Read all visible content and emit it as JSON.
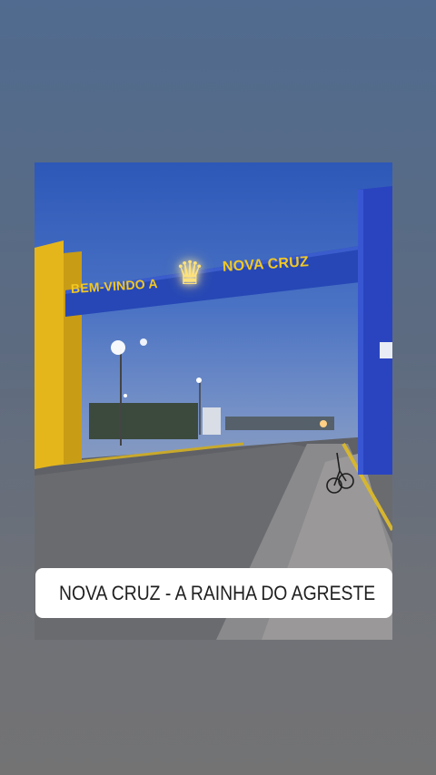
{
  "story": {
    "photo": {
      "arch_sign_left": "BEM-VINDO A",
      "arch_sign_right": "NOVA CRUZ",
      "crown_icon": "crown-icon"
    },
    "location_sticker": {
      "icon": "location-pin-icon",
      "label": "NOVA CRUZ - A RAINHA DO AGRESTE",
      "icon_color": "#2e9df0"
    }
  },
  "colors": {
    "arch_blue": "#2343b0",
    "arch_yellow": "#e8b91e",
    "sign_text": "#f2c823"
  }
}
